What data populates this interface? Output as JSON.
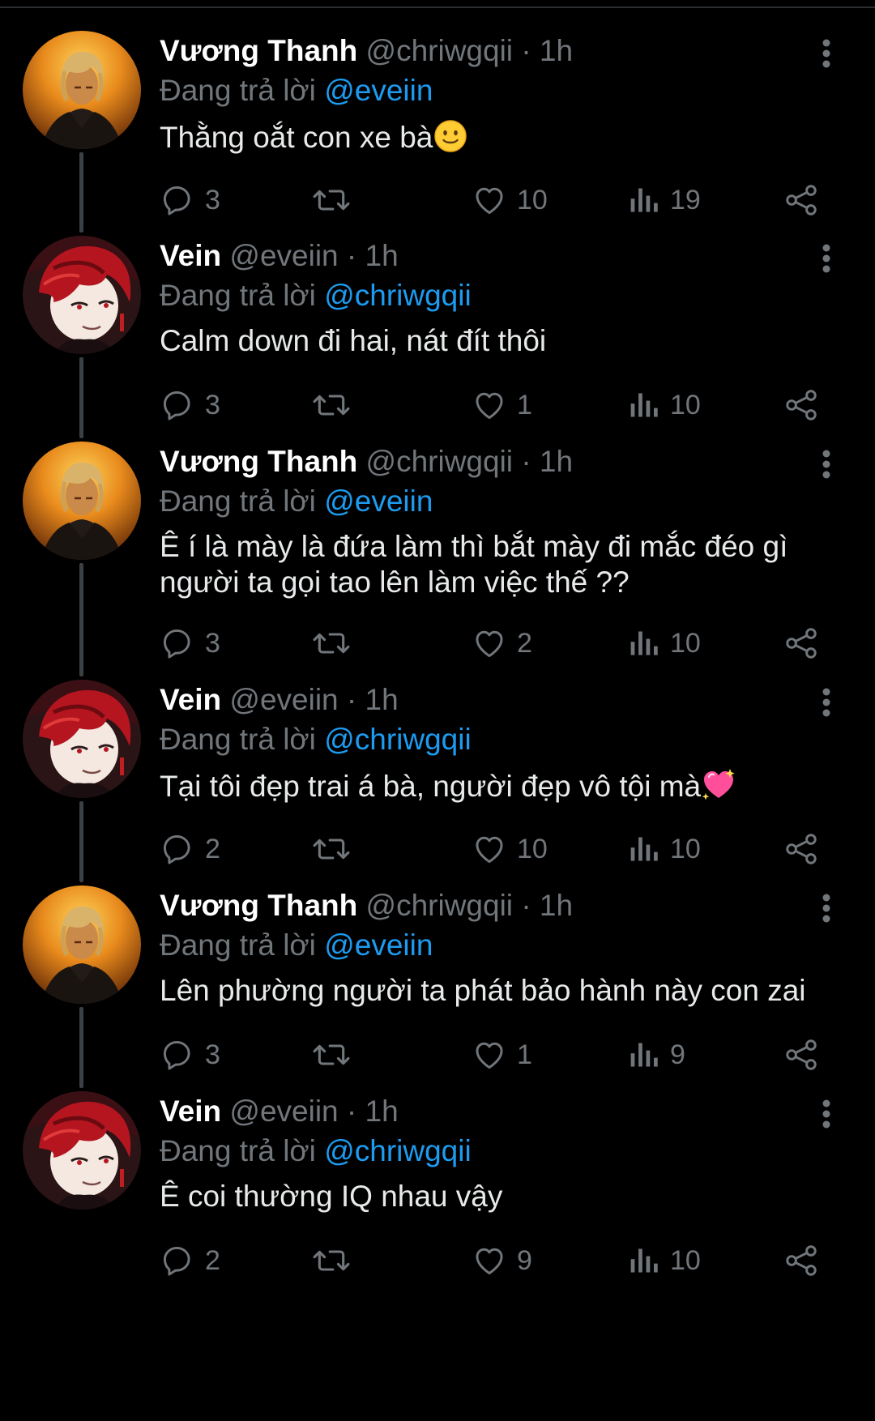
{
  "colors": {
    "background": "#000000",
    "text": "#e7e9ea",
    "muted": "#71767b",
    "mention": "#1d9bf0",
    "thread_line": "#3b4045"
  },
  "tweets": [
    {
      "name": "Vương Thanh",
      "handle": "@chriwgqii",
      "dot": "·",
      "time": "1h",
      "reply_prefix": "Đang trả lời",
      "reply_to": "@eveiin",
      "text": "Thằng oắt con xe bà",
      "emoji": "slightly-smiling-face-emoji",
      "avatar": "avatar-vuong-thanh",
      "replies": "3",
      "likes": "10",
      "views": "19"
    },
    {
      "name": "Vein",
      "handle": "@eveiin",
      "dot": "·",
      "time": "1h",
      "reply_prefix": "Đang trả lời",
      "reply_to": "@chriwgqii",
      "text": "Calm down đi hai, nát đít thôi",
      "emoji": "",
      "avatar": "avatar-vein",
      "replies": "3",
      "likes": "1",
      "views": "10"
    },
    {
      "name": "Vương Thanh",
      "handle": "@chriwgqii",
      "dot": "·",
      "time": "1h",
      "reply_prefix": "Đang trả lời",
      "reply_to": "@eveiin",
      "text": "Ê í là mày là đứa làm thì bắt mày đi mắc đéo gì người ta gọi tao lên làm việc thế ??",
      "emoji": "",
      "avatar": "avatar-vuong-thanh",
      "replies": "3",
      "likes": "2",
      "views": "10"
    },
    {
      "name": "Vein",
      "handle": "@eveiin",
      "dot": "·",
      "time": "1h",
      "reply_prefix": "Đang trả lời",
      "reply_to": "@chriwgqii",
      "text": "Tại tôi đẹp trai á bà, người đẹp vô tội mà",
      "emoji": "sparkling-heart-emoji",
      "avatar": "avatar-vein",
      "replies": "2",
      "likes": "10",
      "views": "10"
    },
    {
      "name": "Vương Thanh",
      "handle": "@chriwgqii",
      "dot": "·",
      "time": "1h",
      "reply_prefix": "Đang trả lời",
      "reply_to": "@eveiin",
      "text": "Lên phường người ta phát bảo hành này con zai",
      "emoji": "",
      "avatar": "avatar-vuong-thanh",
      "replies": "3",
      "likes": "1",
      "views": "9"
    },
    {
      "name": "Vein",
      "handle": "@eveiin",
      "dot": "·",
      "time": "1h",
      "reply_prefix": "Đang trả lời",
      "reply_to": "@chriwgqii",
      "text": "Ê coi thường IQ nhau vậy",
      "emoji": "",
      "avatar": "avatar-vein",
      "replies": "2",
      "likes": "9",
      "views": "10"
    }
  ]
}
